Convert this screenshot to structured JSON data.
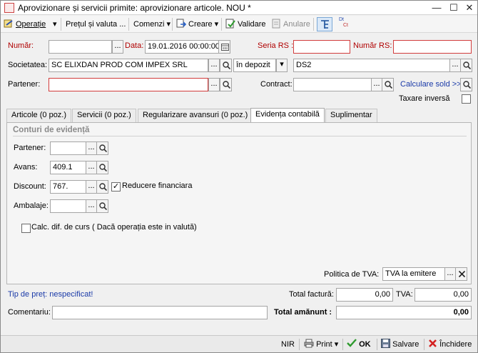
{
  "window": {
    "title": "Aprovizionare și servicii primite: aprovizionare articole. NOU *"
  },
  "toolbar": {
    "operatie": "Operație",
    "pretul": "Prețul și valuta ...",
    "comenzi": "Comenzi",
    "creare": "Creare",
    "validare": "Validare",
    "anulare": "Anulare",
    "dtct_top": "Dt",
    "dtct_bottom": "Ct"
  },
  "header": {
    "numar_label": "Număr:",
    "numar_value": "",
    "data_label": "Data:",
    "data_value": "19.01.2016 00:00:00",
    "seria_rs_label": "Seria RS :",
    "seria_rs_value": "",
    "numar_rs_label": "Număr RS:",
    "numar_rs_value": "",
    "societatea_label": "Societatea:",
    "societatea_value": "SC ELIXDAN PROD COM IMPEX SRL",
    "status_value": "în depozit",
    "depozit_value": "DS2",
    "partener_label": "Partener:",
    "partener_value": "",
    "contract_label": "Contract:",
    "contract_value": "",
    "calculare_sold": "Calculare sold >>",
    "taxare_inversa": "Taxare inversă",
    "ellipsis": "..."
  },
  "tabs": [
    {
      "label": "Articole (0 poz.)",
      "active": false
    },
    {
      "label": "Servicii (0 poz.)",
      "active": false
    },
    {
      "label": "Regularizare avansuri (0 poz.)",
      "active": false
    },
    {
      "label": "Evidența contabilă",
      "active": true
    },
    {
      "label": "Suplimentar",
      "active": false
    }
  ],
  "conturi": {
    "group_title": "Conturi de evidență",
    "partener_label": "Partener:",
    "partener_value": "",
    "avans_label": "Avans:",
    "avans_value": "409.1",
    "discount_label": "Discount:",
    "discount_value": "767.",
    "reducere_label": "Reducere financiara",
    "reducere_checked": true,
    "ambalaje_label": "Ambalaje:",
    "ambalaje_value": "",
    "calc_dif_label": "Calc. dif. de curs ( Dacă operația este in valută)",
    "calc_dif_checked": false,
    "politica_tva_label": "Politica de TVA:",
    "politica_tva_value": "TVA la emitere"
  },
  "footer": {
    "tip_pret": "Tip de preț: nespecificat!",
    "total_factura_label": "Total factură:",
    "total_factura_value": "0,00",
    "tva_label": "TVA:",
    "tva_value": "0,00",
    "comentariu_label": "Comentariu:",
    "comentariu_value": "",
    "total_amanunt_label": "Total amănunt :",
    "total_amanunt_value": "0,00"
  },
  "bottombar": {
    "nir": "NIR",
    "print": "Print",
    "ok": "OK",
    "salvare": "Salvare",
    "inchidere": "Închidere"
  },
  "colors": {
    "required_red": "#b00000",
    "link_blue": "#1a3aa8",
    "ok_green": "#2e9a2e",
    "close_red": "#d42020"
  }
}
